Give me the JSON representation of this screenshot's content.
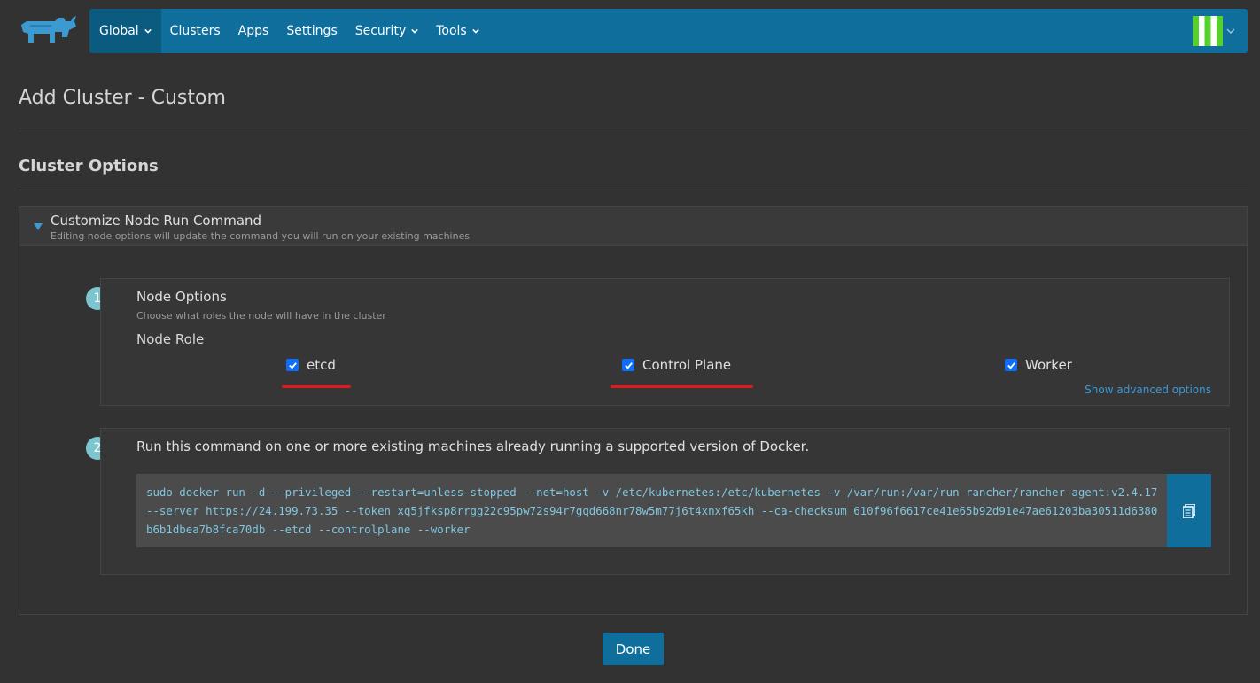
{
  "nav": {
    "items": [
      {
        "label": "Global",
        "has_dropdown": true,
        "active": true
      },
      {
        "label": "Clusters",
        "has_dropdown": false
      },
      {
        "label": "Apps",
        "has_dropdown": false
      },
      {
        "label": "Settings",
        "has_dropdown": false
      },
      {
        "label": "Security",
        "has_dropdown": true
      },
      {
        "label": "Tools",
        "has_dropdown": true
      }
    ],
    "logo_icon": "rancher-cow-logo",
    "avatar_icon": "user-identicon",
    "colors": {
      "bar": "#0f6e9c",
      "active": "#0b5a80"
    }
  },
  "page": {
    "title": "Add Cluster - Custom",
    "section_title": "Cluster Options"
  },
  "accordion": {
    "title": "Customize Node Run Command",
    "subtitle": "Editing node options will update the command you will run on your existing machines",
    "expanded": true
  },
  "step1": {
    "number": "1",
    "title": "Node Options",
    "subtitle": "Choose what roles the node will have in the cluster",
    "role_label": "Node Role",
    "roles": [
      {
        "label": "etcd",
        "checked": true,
        "highlighted": true
      },
      {
        "label": "Control Plane",
        "checked": true,
        "highlighted": true
      },
      {
        "label": "Worker",
        "checked": true,
        "highlighted": false
      }
    ],
    "advanced_link": "Show advanced options"
  },
  "step2": {
    "number": "2",
    "title": "Run this command on one or more existing machines already running a supported version of Docker.",
    "command": "sudo docker run -d --privileged --restart=unless-stopped --net=host -v /etc/kubernetes:/etc/kubernetes -v /var/run:/var/run rancher/rancher-agent:v2.4.17 --server https://24.199.73.35 --token xq5jfksp8rrgg22c95pw72s94r7gqd668nr78w5m77j6t4xnxf65kh --ca-checksum 610f96f6617ce41e65b92d91e47ae61203ba30511d6380b6b1dbea7b8fca70db --etcd --controlplane --worker",
    "copy_icon": "clipboard-icon"
  },
  "footer": {
    "done_label": "Done"
  },
  "colors": {
    "accent": "#0f6e9c",
    "highlight": "#e0191e",
    "step_badge": "#7cc7cf",
    "command_text": "#7fc6e0"
  }
}
